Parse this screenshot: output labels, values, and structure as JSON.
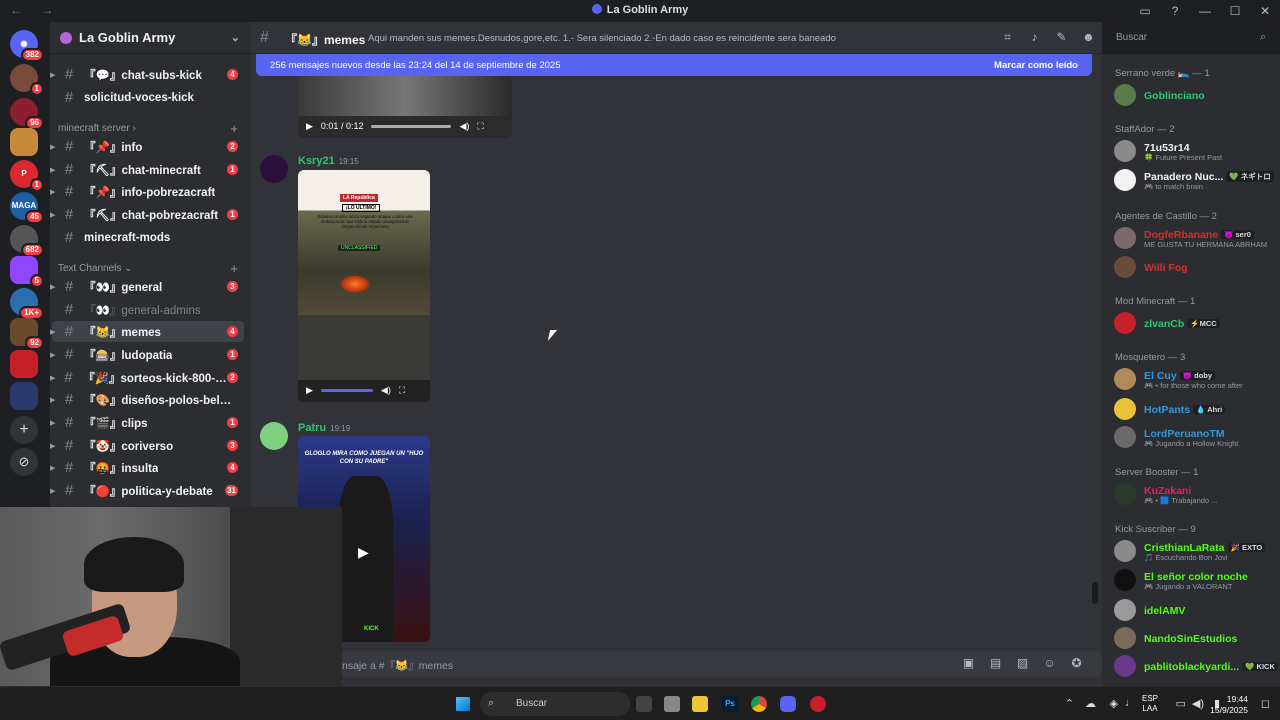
{
  "window": {
    "title": "La Goblin Army",
    "nav": "← →"
  },
  "servers": [
    {
      "badge": "382"
    },
    {
      "badge": "1"
    },
    {
      "badge": "96"
    },
    {
      "badge": ""
    },
    {
      "badge": "1"
    },
    {
      "badge": "45"
    },
    {
      "badge": "682"
    },
    {
      "badge": "5"
    },
    {
      "badge": "1K+"
    },
    {
      "badge": "92"
    },
    {
      "badge": ""
    },
    {
      "badge": ""
    }
  ],
  "server_add": "+",
  "server_explore": "⊘",
  "guild": {
    "name": "La Goblin Army",
    "chevron": "⌄"
  },
  "channels": [
    {
      "label": "『💬』chat-subs-kick",
      "count": "4",
      "muted": false
    },
    {
      "label": "solicitud-voces-kick",
      "count": "",
      "muted": false
    }
  ],
  "cat_minecraft": "minecraft server",
  "channels_mc": [
    {
      "label": "『📌』info",
      "count": "2"
    },
    {
      "label": "『⛏』chat-minecraft",
      "count": "1"
    },
    {
      "label": "『📌』info-pobrezacraft",
      "count": ""
    },
    {
      "label": "『⛏』chat-pobrezacraft",
      "count": "1"
    },
    {
      "label": "minecraft-mods",
      "count": ""
    }
  ],
  "cat_text": "Text Channels",
  "channels_text": [
    {
      "label": "『👀』general",
      "count": "3"
    },
    {
      "label": "『👀』general-admins",
      "count": ""
    },
    {
      "label": "『😹』memes",
      "count": "4"
    },
    {
      "label": "『🎰』ludopatia",
      "count": "1"
    },
    {
      "label": "『🎉』sorteos-kick-800-s...",
      "count": "2"
    },
    {
      "label": "『🎨』diseños-polos-beluga-ar...",
      "count": ""
    },
    {
      "label": "『🎬』clips",
      "count": "1"
    },
    {
      "label": "『🤡』coriverso",
      "count": "3"
    },
    {
      "label": "『🤬』insulta",
      "count": "4"
    },
    {
      "label": "『🔴』politica-y-debate",
      "count": "31"
    }
  ],
  "topbar": {
    "channel": "『😹』memes",
    "topic": "Aqui manden sus memes.Desnudos,gore,etc. 1.- Sera silenciado 2.-En dado caso es reincidente sera baneado"
  },
  "banner": {
    "text": "256 mensajes nuevos desde las 23:24 del 14 de septiembre de 2025",
    "mark": "Marcar como leído"
  },
  "messages": [
    {
      "author": "Ksry21",
      "time": "19:15",
      "color": "#2dc770"
    },
    {
      "author": "Patru",
      "time": "19:19",
      "color": "#2dc770"
    }
  ],
  "video1": {
    "time": "0:01 / 0:12"
  },
  "video2": {
    "overlay_top": "LA República",
    "overlay_tag": "¡LO ÚLTIMO!",
    "overlay_text": "Estados Unidos lanza segundo ataque contra una embarcación que habría estado transportando dr0gas desde Venezuela",
    "overlay_label": "UNCLASSIFIED"
  },
  "video3": {
    "caption": "GLOGLO MIRA COMO JUEGAN UN \"HIJO CON SU PADRE\"",
    "watermark": "KICK"
  },
  "composer": {
    "placeholder": "nsaje a #『😹』memes"
  },
  "search": {
    "placeholder": "Buscar"
  },
  "members": {
    "groups": [
      {
        "title": "Serrano verde 🛌 — 1",
        "members": [
          {
            "name": "Goblinciano",
            "status": "",
            "tag": "",
            "color": "#2dc770"
          }
        ]
      },
      {
        "title": "StaffAdor — 2",
        "members": [
          {
            "name": "71u53r14",
            "status": "🍀 Future Present Past",
            "tag": "",
            "color": "#f2f3f5"
          },
          {
            "name": "Panadero Nuc...",
            "status": "🎮 to match brain",
            "tag": "💚 ネギトロ",
            "color": "#f2f3f5"
          }
        ]
      },
      {
        "title": "Agentes de Castillo — 2",
        "members": [
          {
            "name": "DogfeRbanane",
            "status": "ME GUSTA TU HERMANA ABRHAM",
            "tag": "😈 ser0",
            "color": "#d32f2f"
          },
          {
            "name": "Willi Fog",
            "status": "",
            "tag": "",
            "color": "#d32f2f"
          }
        ]
      },
      {
        "title": "Mod Minecraft — 1",
        "members": [
          {
            "name": "zlvanCb",
            "status": "",
            "tag": "⚡MCC",
            "color": "#2dc770"
          }
        ]
      },
      {
        "title": "Mosquetero — 3",
        "members": [
          {
            "name": "El Cuy",
            "status": "🎮 • for those who come after",
            "tag": "😈 doby",
            "color": "#3498db"
          },
          {
            "name": "HotPants",
            "status": "",
            "tag": "💧 Ahri",
            "color": "#3498db"
          },
          {
            "name": "LordPeruanoTM",
            "status": "🎮 Jugando a Hollow Knight",
            "tag": "",
            "color": "#3498db"
          }
        ]
      },
      {
        "title": "Server Booster — 1",
        "members": [
          {
            "name": "KuZakani",
            "status": "🎮 • 🟦 Trabajando ...",
            "tag": "",
            "color": "#e91e63"
          }
        ]
      },
      {
        "title": "Kick Suscriber — 9",
        "members": [
          {
            "name": "CristhianLaRata",
            "status": "🎵 Escuchando Bon Jovi",
            "tag": "🎉 EXTO",
            "color": "#53fc18"
          },
          {
            "name": "El señor color noche",
            "status": "🎮 Jugando a VALORANT",
            "tag": "",
            "color": "#53fc18"
          },
          {
            "name": "idelAMV",
            "status": "",
            "tag": "",
            "color": "#53fc18"
          },
          {
            "name": "NandoSinEstudios",
            "status": "",
            "tag": "",
            "color": "#53fc18"
          },
          {
            "name": "pablitoblackyardi...",
            "status": "",
            "tag": "💚 KICK",
            "color": "#53fc18"
          }
        ]
      }
    ]
  },
  "taskbar": {
    "search": "Buscar",
    "lang1": "ESP",
    "lang2": "LAA",
    "time": "19:44",
    "date": "15/9/2025"
  }
}
